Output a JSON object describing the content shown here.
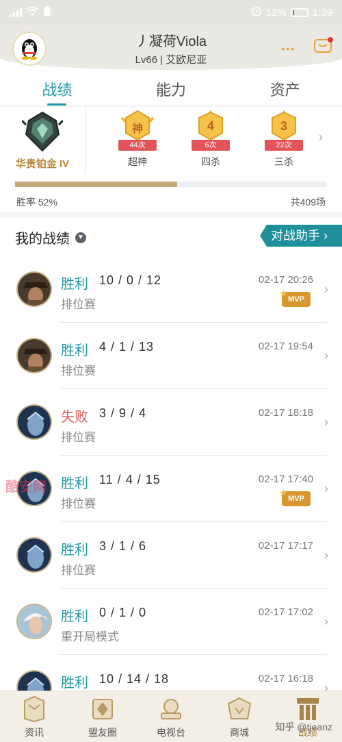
{
  "status_bar": {
    "battery": "12%",
    "time": "1:39",
    "battery_level": 0.12
  },
  "header": {
    "player_name": "丿凝荷Viola",
    "level_server": "Lv66 | 艾欧尼亚",
    "dots": "•••"
  },
  "tabs": [
    {
      "label": "战绩",
      "active": true
    },
    {
      "label": "能力",
      "active": false
    },
    {
      "label": "资产",
      "active": false
    }
  ],
  "rank": {
    "label": "华贵铂金 IV"
  },
  "achievements": [
    {
      "glyph": "神",
      "count": "44次",
      "label": "超神"
    },
    {
      "glyph": "4",
      "count": "6次",
      "label": "四杀"
    },
    {
      "glyph": "3",
      "count": "22次",
      "label": "三杀"
    }
  ],
  "stats": {
    "win_rate_text": "胜率  52%",
    "win_rate": 0.52,
    "total_text": "共409场"
  },
  "section": {
    "title": "我的战绩",
    "assistant_button": "对战助手 ›"
  },
  "matches": [
    {
      "result": "胜利",
      "win": true,
      "kda": "10 / 0 / 12",
      "mode": "排位赛",
      "time": "02-17 20:26",
      "mvp": true,
      "champion_icon": "gunslinger-champion-icon"
    },
    {
      "result": "胜利",
      "win": true,
      "kda": "4 / 1 / 13",
      "mode": "排位赛",
      "time": "02-17 19:54",
      "mvp": false,
      "champion_icon": "gunslinger-champion-icon"
    },
    {
      "result": "失败",
      "win": false,
      "kda": "3 / 9 / 4",
      "mode": "排位赛",
      "time": "02-17 18:18",
      "mvp": false,
      "champion_icon": "shadow-champion-icon"
    },
    {
      "result": "胜利",
      "win": true,
      "kda": "11 / 4 / 15",
      "mode": "排位赛",
      "time": "02-17 17:40",
      "mvp": true,
      "champion_icon": "shadow-champion-icon"
    },
    {
      "result": "胜利",
      "win": true,
      "kda": "3 / 1 / 6",
      "mode": "排位赛",
      "time": "02-17 17:17",
      "mvp": false,
      "champion_icon": "shadow-champion-icon"
    },
    {
      "result": "胜利",
      "win": true,
      "kda": "0 / 1 / 0",
      "mode": "重开局模式",
      "time": "02-17 17:02",
      "mvp": false,
      "champion_icon": "white-hair-champion-icon"
    },
    {
      "result": "胜利",
      "win": true,
      "kda": "10 / 14 / 18",
      "mode": "",
      "time": "02-17 16:18",
      "mvp": false,
      "champion_icon": "shadow-champion-icon"
    }
  ],
  "mvp_label": "MVP",
  "bottom_nav": [
    {
      "label": "资讯",
      "active": false
    },
    {
      "label": "盟友圈",
      "active": false
    },
    {
      "label": "电视台",
      "active": false
    },
    {
      "label": "商城",
      "active": false
    },
    {
      "label": "战绩",
      "active": true
    }
  ],
  "watermark": "知乎 @tjeanz",
  "red_watermark": "酷安网",
  "colors": {
    "accent": "#1e9aa4",
    "loss": "#e05a5a",
    "gold": "#c5a676",
    "mvp": "#d9962f"
  }
}
